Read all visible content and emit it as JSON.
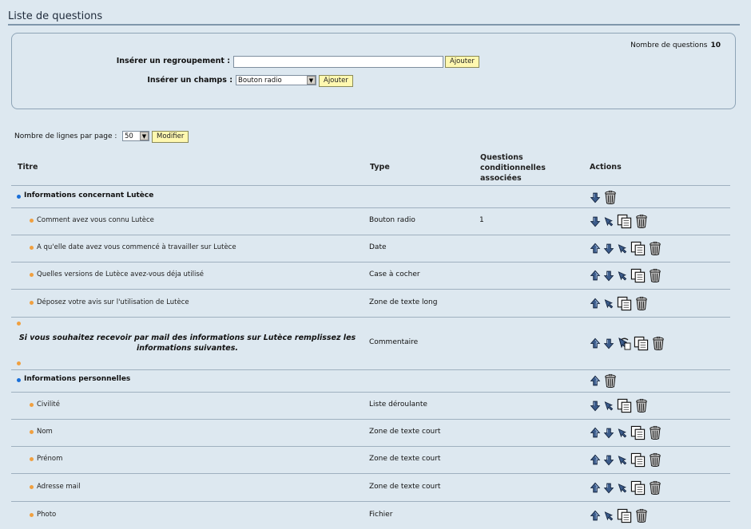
{
  "page": {
    "title": "Liste de questions"
  },
  "panel": {
    "question_count_label": "Nombre de questions",
    "question_count": "10",
    "group_label": "Insérer un regroupement :",
    "group_value": "",
    "group_button": "Ajouter",
    "field_label": "Insérer un champs :",
    "field_selected": "Bouton radio",
    "field_button": "Ajouter"
  },
  "paging": {
    "label": "Nombre de lignes par page :",
    "selected": "50",
    "button": "Modifier"
  },
  "table": {
    "headers": {
      "title": "Titre",
      "type": "Type",
      "cond1": "Questions",
      "cond2": "conditionnelles",
      "cond3": "associées",
      "actions": "Actions"
    },
    "rows": [
      {
        "kind": "group",
        "title": "Informations concernant Lutèce",
        "type": "",
        "cond": "",
        "actions": [
          "down",
          "delete"
        ]
      },
      {
        "kind": "item",
        "title": "Comment avez vous connu Lutèce",
        "type": "Bouton radio",
        "cond": "1",
        "actions": [
          "down",
          "move",
          "copy",
          "delete"
        ]
      },
      {
        "kind": "item",
        "title": "A qu'elle date avez vous commencé à travailler sur Lutèce",
        "type": "Date",
        "cond": "",
        "actions": [
          "up",
          "down",
          "move",
          "copy",
          "delete"
        ]
      },
      {
        "kind": "item",
        "title": "Quelles versions de Lutèce avez-vous déja utilisé",
        "type": "Case à cocher",
        "cond": "",
        "actions": [
          "up",
          "down",
          "move",
          "copy",
          "delete"
        ]
      },
      {
        "kind": "item",
        "title": "Déposez votre avis sur l'utilisation de Lutèce",
        "type": "Zone de texte long",
        "cond": "",
        "actions": [
          "up",
          "move",
          "copy",
          "delete"
        ]
      },
      {
        "kind": "comment",
        "title": "Si vous souhaitez recevoir par mail des informations sur Lutèce remplissez les informations suivantes.",
        "type": "Commentaire",
        "cond": "",
        "actions": [
          "up",
          "down",
          "moveout",
          "copy",
          "delete"
        ]
      },
      {
        "kind": "group",
        "title": "Informations personnelles",
        "type": "",
        "cond": "",
        "actions": [
          "up",
          "delete"
        ]
      },
      {
        "kind": "item",
        "title": "Civilité",
        "type": "Liste déroulante",
        "cond": "",
        "actions": [
          "down",
          "move",
          "copy",
          "delete"
        ]
      },
      {
        "kind": "item",
        "title": "Nom",
        "type": "Zone de texte court",
        "cond": "",
        "actions": [
          "up",
          "down",
          "move",
          "copy",
          "delete"
        ]
      },
      {
        "kind": "item",
        "title": "Prénom",
        "type": "Zone de texte court",
        "cond": "",
        "actions": [
          "up",
          "down",
          "move",
          "copy",
          "delete"
        ]
      },
      {
        "kind": "item",
        "title": "Adresse mail",
        "type": "Zone de texte court",
        "cond": "",
        "actions": [
          "up",
          "down",
          "move",
          "copy",
          "delete"
        ]
      },
      {
        "kind": "item",
        "title": "Photo",
        "type": "Fichier",
        "cond": "",
        "actions": [
          "up",
          "move",
          "copy",
          "delete"
        ]
      }
    ]
  },
  "colors": {
    "background": "#dde8f0",
    "button": "#fff8b0",
    "group_bullet": "#1a6fd8",
    "item_bullet": "#f0a040"
  }
}
